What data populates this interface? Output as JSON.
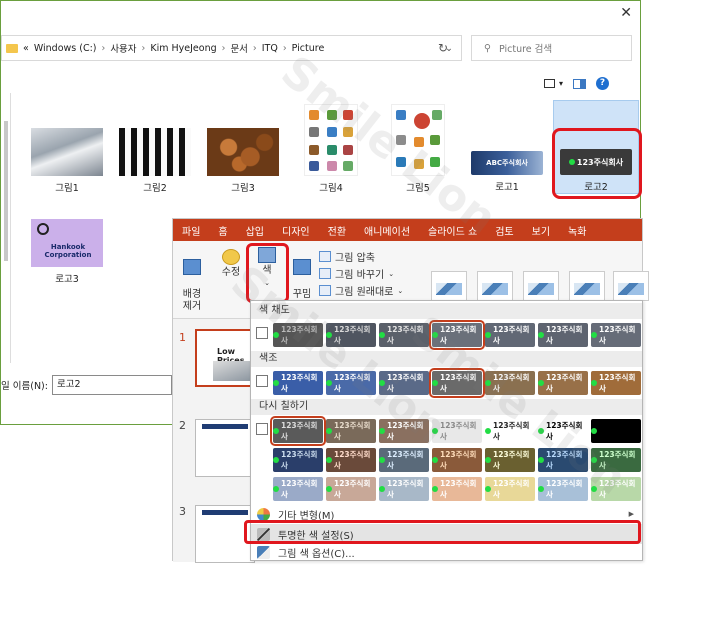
{
  "explorer": {
    "close_glyph": "✕",
    "breadcrumb": [
      "Windows (C:)",
      "사용자",
      "Kim HyeJeong",
      "문서",
      "ITQ",
      "Picture"
    ],
    "breadcrumb_prefix": "«",
    "search_placeholder": "Picture 검색",
    "files": [
      {
        "name": "그림1",
        "kind": "keyboard"
      },
      {
        "name": "그림2",
        "kind": "piano"
      },
      {
        "name": "그림3",
        "kind": "coffee"
      },
      {
        "name": "그림4",
        "kind": "icons"
      },
      {
        "name": "그림5",
        "kind": "icons"
      },
      {
        "name": "로고1",
        "kind": "logo"
      },
      {
        "name": "로고2",
        "kind": "logo",
        "selected": true
      },
      {
        "name": "로고3",
        "kind": "logo"
      }
    ],
    "logo1_text": "ABC주식회사",
    "logo2_text": "123주식회사",
    "logo3_text": "Hankook Corporation",
    "filename_label": "일 이름(N):",
    "filename_value": "로고2"
  },
  "ppt": {
    "tabs": [
      "파일",
      "홈",
      "삽입",
      "디자인",
      "전환",
      "애니메이션",
      "슬라이드 쇼",
      "검토",
      "보기",
      "녹화"
    ],
    "ribbon": {
      "bg_remove": "배경\n제거",
      "correct": "수정",
      "color": "색",
      "artistic": "꾸밈\n효과",
      "compress": "그림 압축",
      "change": "그림 바꾸기",
      "reset": "그림 원래대로"
    },
    "slide_numbers": [
      "1",
      "2",
      "3"
    ],
    "slide1_text": "Low Prices"
  },
  "color_menu": {
    "saturation_label": "색 채도",
    "tone_label": "색조",
    "recolor_label": "다시 칠하기",
    "swatch_text": "123주식회사",
    "more_variations": "기타 변형(M)",
    "set_transparent": "투명한 색 설정(S)",
    "picture_options": "그림 색 옵션(C)..."
  },
  "watermark": "Smile Lion",
  "colors": {
    "accent": "#c43e1c",
    "highlight": "#e0171e",
    "selection": "#cfe3f8"
  }
}
